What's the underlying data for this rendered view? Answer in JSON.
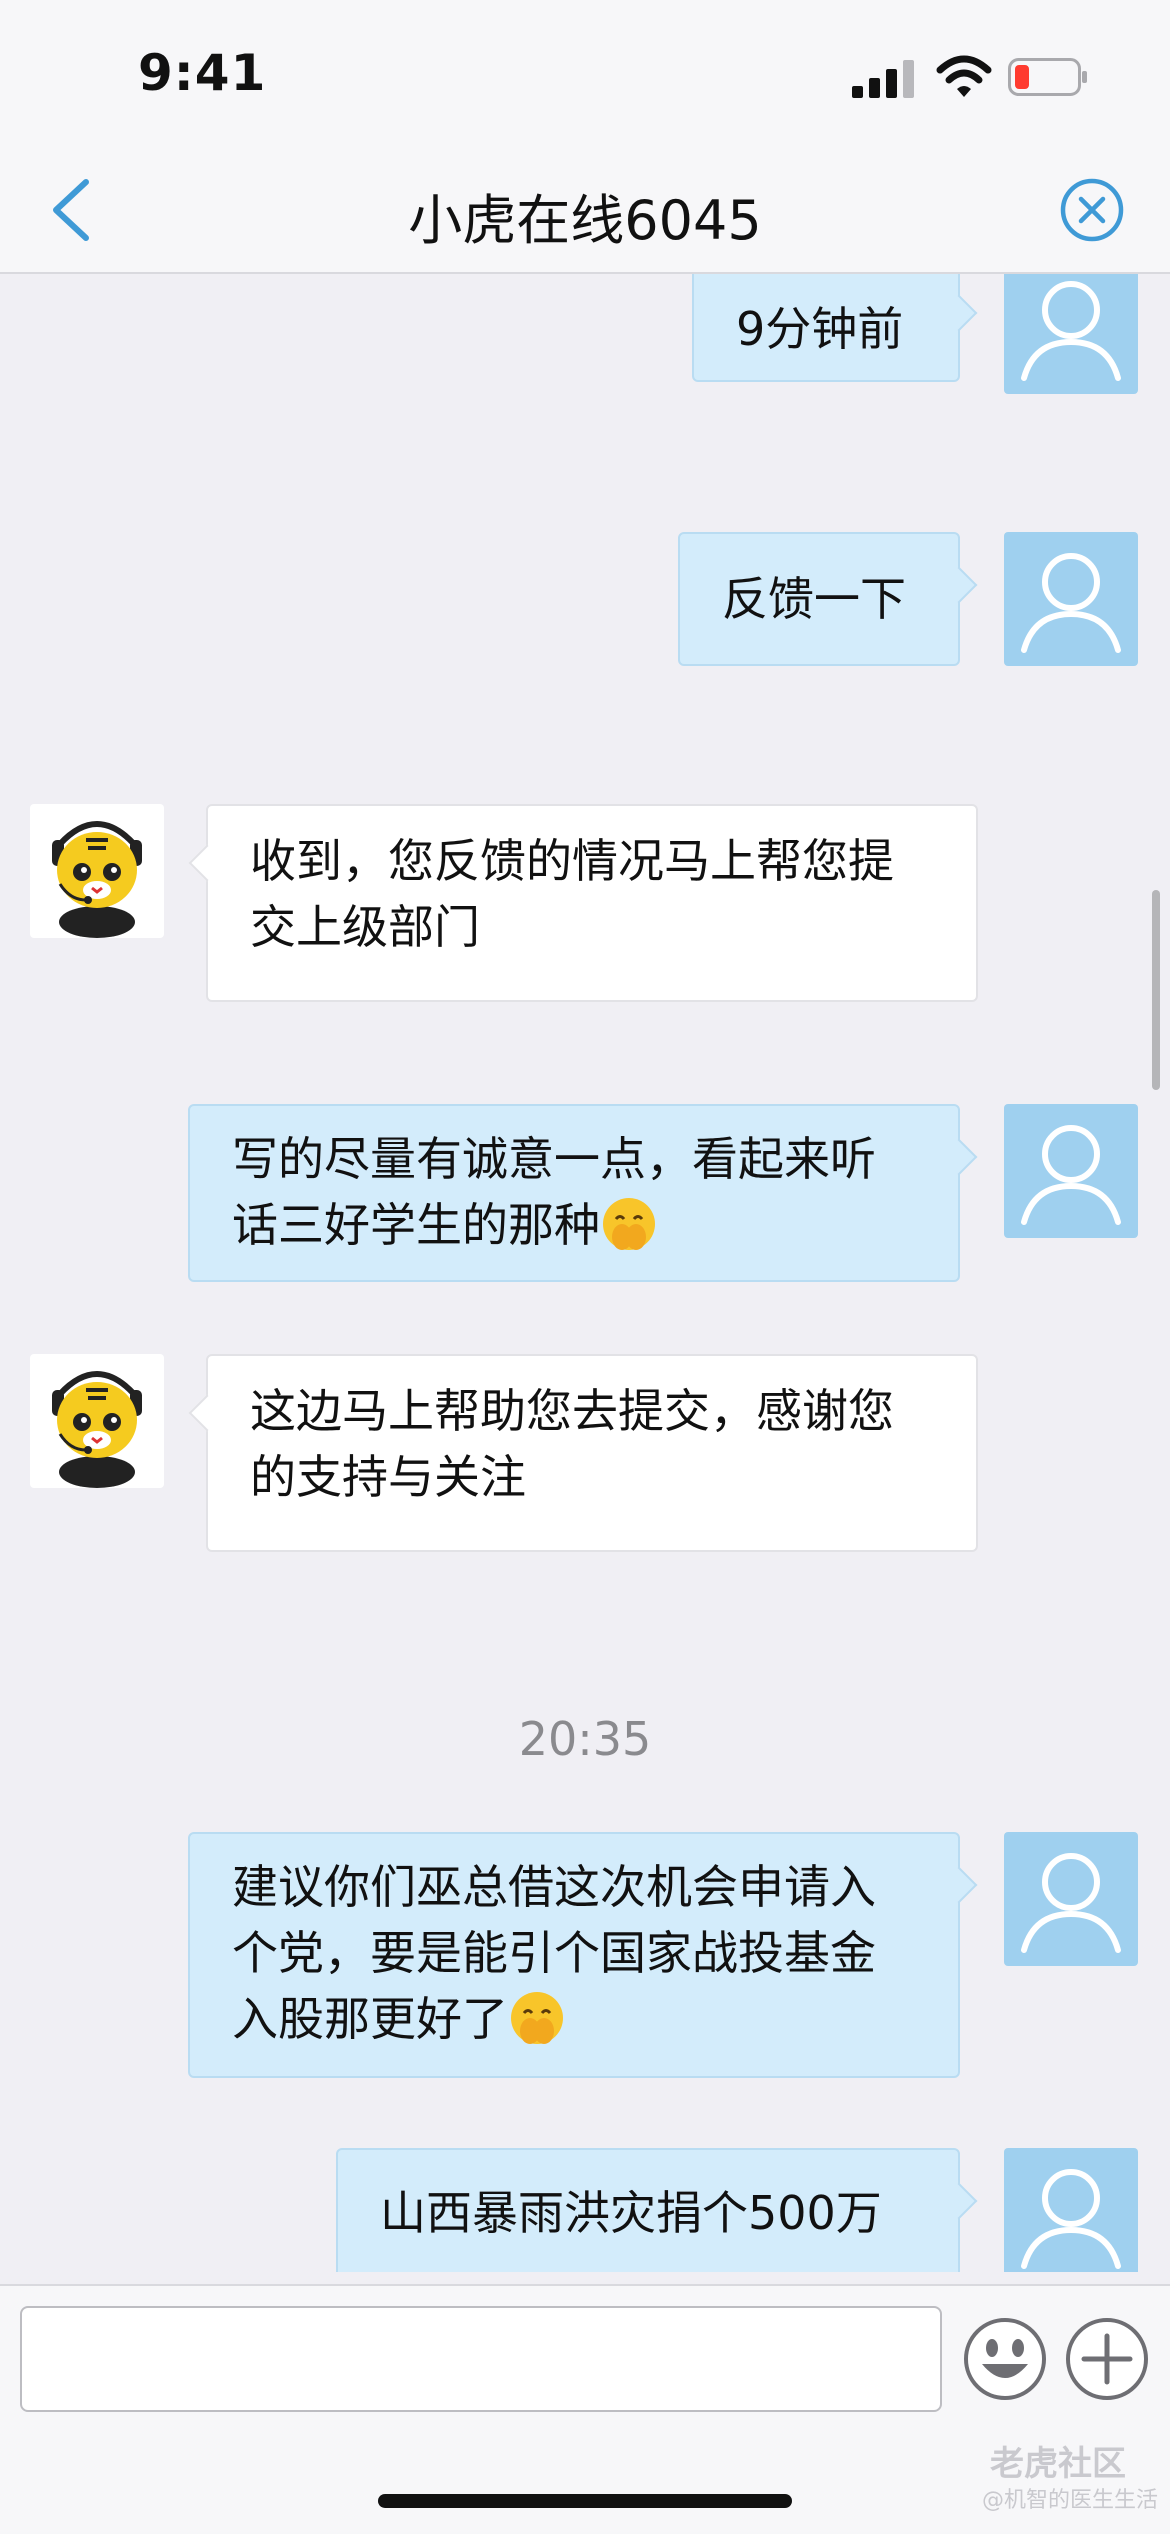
{
  "status_bar": {
    "time": "9:41"
  },
  "header": {
    "title": "小虎在线6045"
  },
  "messages": [
    {
      "from": "user",
      "text": "9分钟前"
    },
    {
      "from": "user",
      "text": "反馈一下"
    },
    {
      "from": "agent",
      "text": "收到，您反馈的情况马上帮您提交上级部门"
    },
    {
      "from": "user",
      "text": "写的尽量有诚意一点，看起来听话三好学生的那种",
      "emoji": "hands-over-mouth-emoji"
    },
    {
      "from": "agent",
      "text": "这边马上帮助您去提交，感谢您的支持与关注"
    },
    {
      "type": "time",
      "text": "20:35"
    },
    {
      "from": "user",
      "text": "建议你们巫总借这次机会申请入个党，要是能引个国家战投基金入股那更好了",
      "emoji": "hands-over-mouth-emoji"
    },
    {
      "from": "user",
      "text": "山西暴雨洪灾捐个500万"
    }
  ],
  "input": {
    "value": "",
    "placeholder": ""
  },
  "watermark": {
    "line1": "老虎社区",
    "line2": "@机智的医生生活"
  },
  "colors": {
    "accent": "#3f9ad6",
    "user_bubble": "#d3ecfb",
    "avatar_user": "#9fd0ef",
    "battery_low": "#ff3b30"
  }
}
